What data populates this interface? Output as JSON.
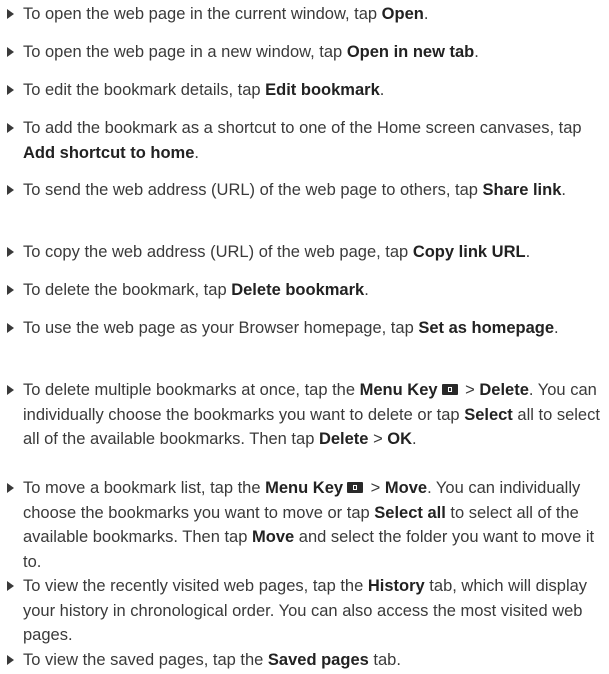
{
  "items": [
    {
      "pre": "To open the web page in the current window, tap ",
      "b1": "Open",
      "post": "."
    },
    {
      "pre": "To open the web page in a new window, tap ",
      "b1": "Open in new tab",
      "post": "."
    },
    {
      "pre": "To edit the bookmark details, tap ",
      "b1": "Edit bookmark",
      "post": "."
    },
    {
      "pre": "To add the bookmark as a shortcut to one of the Home screen canvases, tap ",
      "b1": "Add shortcut to home",
      "post": "."
    },
    {
      "pre": "To send the web address (URL) of the web page to others, tap ",
      "b1": "Share link",
      "post": "."
    },
    {
      "pre": "To copy the web address (URL) of the web page, tap ",
      "b1": "Copy link URL",
      "post": "."
    },
    {
      "pre": "To delete the bookmark, tap ",
      "b1": "Delete bookmark",
      "post": "."
    },
    {
      "pre": "To use the web page as your Browser homepage, tap ",
      "b1": "Set as homepage",
      "post": "."
    },
    {
      "t1": "To delete multiple bookmarks at once, tap the ",
      "b1": "Menu Key",
      "t2": " > ",
      "b2": "Delete",
      "t3": ". You can individually choose the bookmarks you want to delete or tap ",
      "b3": "Select",
      "t4": " all to select all of the available bookmarks. Then tap ",
      "b4": "Delete",
      "t5": " > ",
      "b5": "OK",
      "t6": "."
    },
    {
      "t1": "To move a bookmark list, tap the ",
      "b1": "Menu Key",
      "t2": " > ",
      "b2": "Move",
      "t3": ". You can individually choose the bookmarks you want to move or tap ",
      "b3": "Select all",
      "t4": " to select all of the available bookmarks. Then tap ",
      "b4": "Move",
      "t5": " and select the folder you want to move it to."
    },
    {
      "pre": "To view the recently visited web pages, tap the ",
      "b1": "History",
      "post": " tab, which will display your history in chronological order. You can also access the most visited web pages."
    },
    {
      "pre": "To view the saved pages, tap the ",
      "b1": "Saved pages",
      "post": " tab."
    }
  ],
  "icons": {
    "menu_key": "menu-key-icon",
    "bullet": "right-triangle-bullet-icon"
  },
  "colors": {
    "text": "#3a3a3a",
    "bold": "#222222",
    "background": "#ffffff"
  }
}
